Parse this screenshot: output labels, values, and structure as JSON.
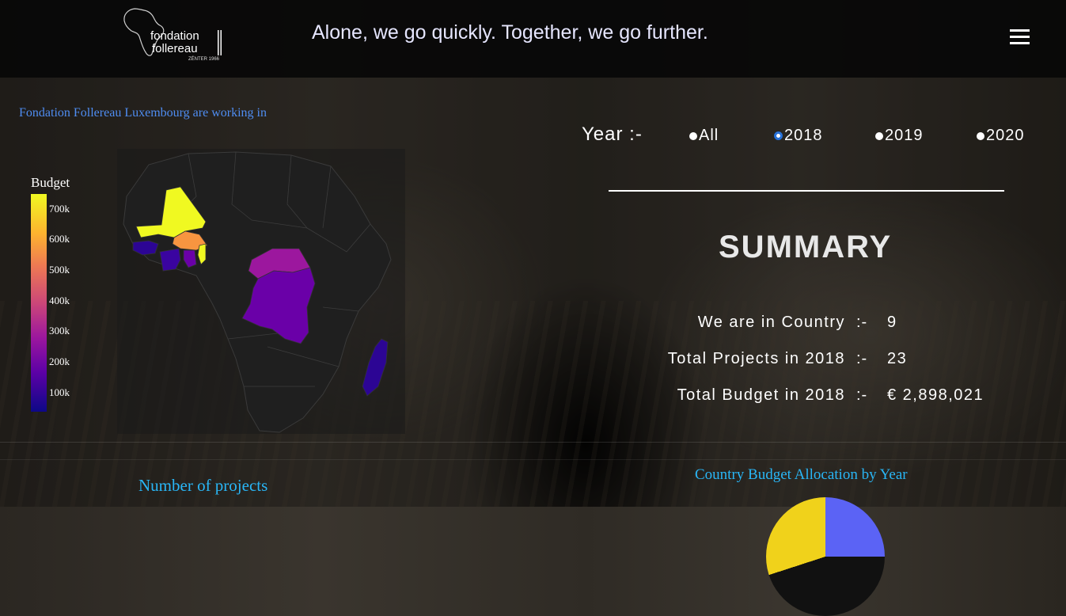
{
  "header": {
    "logo": {
      "line1": "fondation",
      "line2": "follereau",
      "line3": "ZÉNTER 1966"
    },
    "tagline": "Alone, we go quickly. Together, we go further.",
    "menu_icon": "hamburger-menu-icon"
  },
  "map": {
    "title": "Fondation Follereau Luxembourg are working in",
    "colorbar": {
      "title": "Budget",
      "ticks": [
        "700k",
        "600k",
        "500k",
        "400k",
        "300k",
        "200k",
        "100k"
      ]
    }
  },
  "year_filter": {
    "label": "Year :-",
    "options": [
      "All",
      "2018",
      "2019",
      "2020"
    ],
    "selected": "2018"
  },
  "summary": {
    "title": "SUMMARY",
    "rows": [
      {
        "label": "We are in Country",
        "sep": ":-",
        "value": "9"
      },
      {
        "label": "Total Projects in 2018",
        "sep": ":-",
        "value": "23"
      },
      {
        "label": "Total Budget in 2018",
        "sep": ":-",
        "value": "€ 2,898,021"
      }
    ]
  },
  "sections": {
    "left_title": "Number of projects",
    "right_title": "Country Budget Allocation by Year"
  },
  "colors": {
    "yellow": "#f0f921",
    "orange": "#f89540",
    "magenta": "#9c179e",
    "purple": "#6a00a8",
    "blue": "#2c0594",
    "accent_blue": "#29b6f6",
    "map_title_blue": "#4f8df2"
  }
}
